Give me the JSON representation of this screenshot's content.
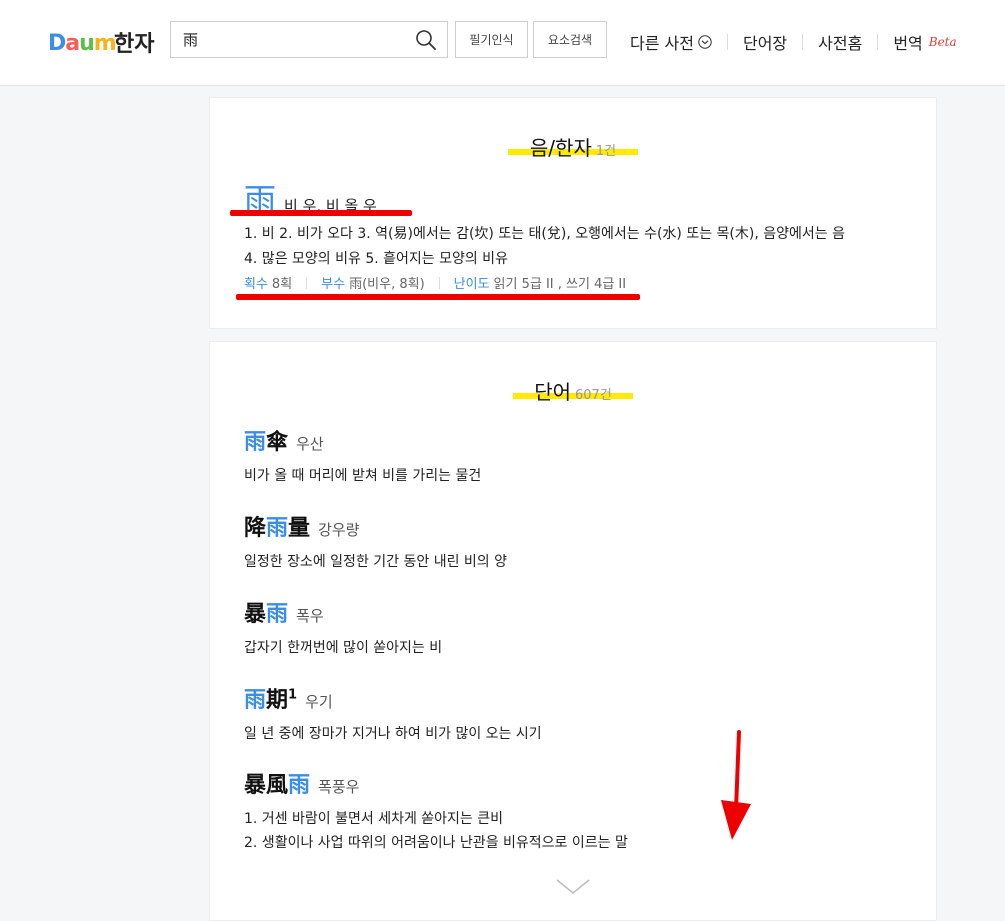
{
  "header": {
    "logo": [
      "D",
      "a",
      "u",
      "m"
    ],
    "logo_colors": [
      "#3b8ee3",
      "#ff5b5b",
      "#5bc04a",
      "#f9b21e"
    ],
    "service": "한자",
    "search": {
      "value": "雨"
    },
    "handwriting_label": "필기인식",
    "element_search_label": "요소검색",
    "nav": {
      "other_dict": "다른 사전",
      "wordbook": "단어장",
      "dict_home": "사전홈",
      "translate": "번역",
      "beta": "Beta"
    }
  },
  "hanja_section": {
    "title": "음/한자",
    "count": "1건",
    "char": "雨",
    "reading": "비 우, 비 올 우",
    "meaning_line1": "1.  비      2.  비가 오다      3.  역(易)에서는 감(坎) 또는 태(兌), 오행에서는 수(水) 또는 목(木), 음양에서는 음",
    "meaning_line2": "4.  많은 모양의 비유      5.  흩어지는 모양의 비유",
    "strokes_key": "획수",
    "strokes_val": "8획",
    "radical_key": "부수",
    "radical_val": "雨(비우, 8획)",
    "level_key": "난이도",
    "level_val": "읽기 5급 II , 쓰기 4급 II"
  },
  "word_section": {
    "title": "단어",
    "count": "607건",
    "words": [
      {
        "parts": [
          {
            "t": "雨",
            "blue": true
          },
          {
            "t": "傘",
            "blue": false
          }
        ],
        "sup": "",
        "reading": "우산",
        "defs": [
          "비가 올 때 머리에 받쳐 비를 가리는 물건"
        ]
      },
      {
        "parts": [
          {
            "t": "降",
            "blue": false
          },
          {
            "t": "雨",
            "blue": true
          },
          {
            "t": "量",
            "blue": false
          }
        ],
        "sup": "",
        "reading": "강우량",
        "defs": [
          "일정한 장소에 일정한 기간 동안 내린 비의 양"
        ]
      },
      {
        "parts": [
          {
            "t": "暴",
            "blue": false
          },
          {
            "t": "雨",
            "blue": true
          }
        ],
        "sup": "",
        "reading": "폭우",
        "defs": [
          "갑자기 한꺼번에 많이 쏟아지는 비"
        ]
      },
      {
        "parts": [
          {
            "t": "雨",
            "blue": true
          },
          {
            "t": "期",
            "blue": false
          }
        ],
        "sup": "1",
        "reading": "우기",
        "defs": [
          "일 년 중에 장마가 지거나 하여 비가 많이 오는 시기"
        ]
      },
      {
        "parts": [
          {
            "t": "暴",
            "blue": false
          },
          {
            "t": "風",
            "blue": false
          },
          {
            "t": "雨",
            "blue": true
          }
        ],
        "sup": "",
        "reading": "폭풍우",
        "defs": [
          "1.  거센 바람이 불면서 세차게 쏟아지는 큰비",
          "2.  생활이나 사업 따위의 어려움이나 난관을 비유적으로 이르는 말"
        ]
      }
    ]
  },
  "colors": {
    "accent": "#3b8ee3",
    "highlight": "#ffea00",
    "annotation": "#e00000"
  }
}
